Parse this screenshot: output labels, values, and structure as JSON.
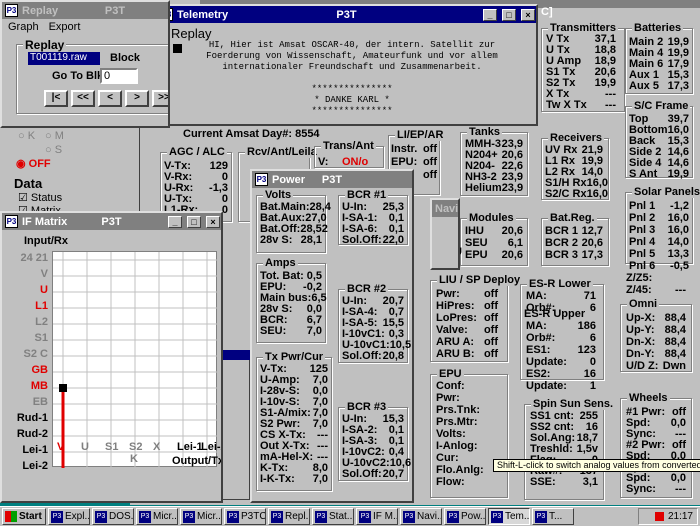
{
  "replay": {
    "title": "Replay",
    "menu": [
      "Graph",
      "Export"
    ],
    "group_label": "Replay",
    "file": "T001119.raw",
    "block_label": "Block",
    "block_value": "4",
    "goto_label": "Go To Blk:",
    "goto_value": "0",
    "nav_buttons": [
      "|<",
      "<<",
      "<",
      ">",
      ">>"
    ],
    "radio_k": "K",
    "radio_m": "M",
    "radio_s": "S",
    "radio_off": "OFF",
    "data_label": "Data",
    "chk_status": "Status",
    "chk_matrix": "Matrix"
  },
  "telemetry": {
    "title": "Telemetry",
    "center": "P3T",
    "heading": "Replay",
    "text": "HI, Hier ist Amsat OSCAR-40, der intern. Satellit zur Foerderung von Wissenschaft, Amateurfunk und vor allem internationaler Freundschaft und Zusammenarbeit.\n\n***************\n* DANKE KARL *\n***************"
  },
  "main_bg": {
    "current_label": "Current Amsat Day#:",
    "current_value": "8554",
    "agc_title": "AGC / ALC",
    "agc": [
      [
        "V-Tx:",
        "129"
      ],
      [
        "V-Rx:",
        "0"
      ],
      [
        "U-Rx:",
        "-1,3"
      ],
      [
        "U-Tx:",
        "0"
      ],
      [
        "L1-Rx:",
        "0"
      ]
    ],
    "rcv_title": "Rcv/Ant/Leila",
    "trans_title": "Trans/Ant",
    "trans_v": "V:",
    "trans_val": "ON/o",
    "liep_title": "LI/EP/AR",
    "liep": [
      [
        "Instr.",
        "off"
      ],
      [
        "EPU:",
        "off"
      ],
      [
        "In:",
        "off"
      ]
    ]
  },
  "right_panel": {
    "transmitters_title": "Transmitters",
    "transmitters": [
      [
        "V Tx",
        "37,1"
      ],
      [
        "U Tx",
        "18,8"
      ],
      [
        "U Amp",
        "18,9"
      ],
      [
        "S1 Tx",
        "20,6"
      ],
      [
        "S2 Tx",
        "19,9"
      ],
      [
        "X Tx",
        "---"
      ],
      [
        "Tw X Tx",
        "---"
      ]
    ],
    "batteries_title": "Batteries",
    "batteries": [
      [
        "Main 2",
        "19,9"
      ],
      [
        "Main 4",
        "19,9"
      ],
      [
        "Main 6",
        "17,9"
      ],
      [
        "Aux 1",
        "15,3"
      ],
      [
        "Aux 5",
        "17,3"
      ]
    ],
    "sc_title": "S/C Frame",
    "sc": [
      [
        "Top",
        "39,7"
      ],
      [
        "Bottom",
        "16,0"
      ],
      [
        "Back",
        "15,3"
      ],
      [
        "Side 2",
        "14,6"
      ],
      [
        "Side 4",
        "14,6"
      ],
      [
        "S Ant",
        "19,9"
      ]
    ],
    "tanks_title": "Tanks",
    "tanks": [
      [
        "MMH-3",
        "23,9"
      ],
      [
        "N204+",
        "20,6"
      ],
      [
        "N204-",
        "22,6"
      ],
      [
        "NH3-2",
        "23,9"
      ],
      [
        "Helium",
        "23,9"
      ]
    ],
    "receivers_title": "Receivers",
    "receivers": [
      [
        "UV Rx",
        "21,9"
      ],
      [
        "L1 Rx",
        "19,9"
      ],
      [
        "L2 Rx",
        "14,0"
      ],
      [
        "S1/H Rx",
        "16,0"
      ],
      [
        "S2/C Rx",
        "16,0"
      ]
    ],
    "solar_title": "Solar Panels",
    "solar": [
      [
        "Pnl 1",
        "-1,2"
      ],
      [
        "Pnl 2",
        "16,0"
      ],
      [
        "Pnl 3",
        "16,0"
      ],
      [
        "Pnl 4",
        "14,0"
      ],
      [
        "Pnl 5",
        "13,3"
      ],
      [
        "Pnl 6",
        "-0,5"
      ]
    ],
    "modules_title": "Modules",
    "modules": [
      [
        "IHU",
        "20,6"
      ],
      [
        "SEU",
        "6,1"
      ],
      [
        "EPU",
        "20,6"
      ]
    ],
    "batreg_title": "Bat.Reg.",
    "batreg": [
      [
        "BCR 1",
        "12,7"
      ],
      [
        "BCR 2",
        "20,6"
      ],
      [
        "BCR 3",
        "17,3"
      ]
    ],
    "z": [
      [
        "Z/Z5:",
        ""
      ],
      [
        "Z/45:",
        "---"
      ]
    ],
    "omni_title": "Omni",
    "omni": [
      [
        "Up-X:",
        "88,4"
      ],
      [
        "Up-Y:",
        "88,4"
      ],
      [
        "Dn-X:",
        "88,4"
      ],
      [
        "Dn-Y:",
        "88,4"
      ],
      [
        "U/D Z:",
        "Dwn"
      ]
    ],
    "wheels_title": "Wheels",
    "wheels": [
      [
        "#1 Pwr:",
        "off"
      ],
      [
        "Spd:",
        "0,0"
      ],
      [
        "Sync:",
        "---"
      ],
      [
        "#2 Pwr:",
        "off"
      ],
      [
        "Spd:",
        "0,0"
      ],
      [
        "Sync:",
        "---"
      ],
      [
        "Spd:",
        "0,0"
      ],
      [
        "Sync:",
        "---"
      ]
    ],
    "liu_title": "LIU / SP Deploy",
    "liu": [
      [
        "Pwr:",
        "off"
      ],
      [
        "HiPres:",
        "off"
      ],
      [
        "LoPres:",
        "off"
      ],
      [
        "Valve:",
        "off"
      ],
      [
        "ARU A:",
        "off"
      ],
      [
        "ARU B:",
        "off"
      ]
    ],
    "esr_lower": "ES-R Lower",
    "esr_lower_rows": [
      [
        "MA:",
        "71"
      ],
      [
        "Orb#:",
        "6"
      ]
    ],
    "esr_upper": "ES-R Upper",
    "esr_upper_rows": [
      [
        "MA:",
        "186"
      ],
      [
        "Orb#:",
        "6"
      ],
      [
        "ES1:",
        "123"
      ],
      [
        "Update:",
        "0"
      ],
      [
        "ES2:",
        "16"
      ],
      [
        "Update:",
        "1"
      ]
    ],
    "epu_title": "EPU",
    "epu": [
      [
        "Conf:",
        ""
      ],
      [
        "Pwr:",
        ""
      ],
      [
        "Prs.Tnk:",
        ""
      ],
      [
        "Prs.Mtr:",
        ""
      ],
      [
        "Volts:",
        ""
      ],
      [
        "I-Anlog:",
        ""
      ],
      [
        "Cur:",
        ""
      ],
      [
        "Flo.Anlg:",
        ""
      ],
      [
        "Flow:",
        ""
      ]
    ],
    "spin_title": "Spin Sun Sens.",
    "spin": [
      [
        "SS1 cnt:",
        "255"
      ],
      [
        "SS2 cnt:",
        "16"
      ],
      [
        "Sol.Ang:",
        "18,7"
      ],
      [
        "Treshld:",
        "1,5v"
      ],
      [
        "Flag:",
        "0"
      ],
      [
        "Raw#:",
        "137"
      ],
      [
        "SSE:",
        "3,1"
      ]
    ],
    "stat_prefix": "Stat",
    "mod_prefix": [
      "Mod",
      "Mag",
      "M-SU"
    ],
    "nav_prefix": "Navi",
    "c_prefix": "C]"
  },
  "power": {
    "title": "Power",
    "center": "P3T",
    "volts_title": "Volts",
    "volts": [
      [
        "Bat.Main:",
        "28,4"
      ],
      [
        "Bat.Aux:",
        "27,0"
      ],
      [
        "Bat.Off:",
        "28,52"
      ],
      [
        "28v S:",
        "28,1"
      ]
    ],
    "amps_title": "Amps",
    "amps": [
      [
        "Tot. Bat:",
        "0,5"
      ],
      [
        "EPU:",
        "-0,2"
      ],
      [
        "Main bus:",
        "6,5"
      ],
      [
        "28v S:",
        "0,0"
      ],
      [
        "BCR:",
        "6,7"
      ],
      [
        "SEU:",
        "7,0"
      ]
    ],
    "txpwr_title": "Tx Pwr/Cur",
    "txpwr": [
      [
        "V-Tx:",
        "125"
      ],
      [
        "U-Amp:",
        "7,0"
      ],
      [
        "I-28v-S:",
        "0,0"
      ],
      [
        "I-10v-S:",
        "7,0"
      ],
      [
        "S1-A/mix:",
        "7,0"
      ],
      [
        "S2 Pwr:",
        "7,0"
      ],
      [
        "CS X-Tx:",
        "---"
      ],
      [
        "Out X-Tx:",
        "---"
      ],
      [
        "mA-Hel-X:",
        "---"
      ],
      [
        "K-Tx:",
        "8,0"
      ],
      [
        "I-K-Tx:",
        "7,0"
      ]
    ],
    "bcr1_title": "BCR #1",
    "bcr1": [
      [
        "U-In:",
        "25,3"
      ],
      [
        "I-SA-1:",
        "0,1"
      ],
      [
        "I-SA-6:",
        "0,1"
      ],
      [
        "Sol.Off:",
        "22,0"
      ]
    ],
    "bcr2_title": "BCR #2",
    "bcr2": [
      [
        "U-In:",
        "20,7"
      ],
      [
        "I-SA-4:",
        "0,7"
      ],
      [
        "I-SA-5:",
        "15,5"
      ],
      [
        "I-10vC1:",
        "0,3"
      ],
      [
        "U-10vC1:",
        "10,5"
      ],
      [
        "Sol.Off:",
        "20,8"
      ]
    ],
    "bcr3_title": "BCR #3",
    "bcr3": [
      [
        "U-In:",
        "15,3"
      ],
      [
        "I-SA-2:",
        "0,1"
      ],
      [
        "I-SA-3:",
        "0,1"
      ],
      [
        "I-10vC2:",
        "0,4"
      ],
      [
        "U-10vC2:",
        "10,6"
      ],
      [
        "Sol.Off:",
        "20,7"
      ]
    ]
  },
  "ifmatrix": {
    "title": "IF Matrix",
    "center": "P3T",
    "corner": "Input/Rx",
    "rows": [
      {
        "label": "24 21",
        "color": "#808080"
      },
      {
        "label": "V",
        "color": "#808080"
      },
      {
        "label": "U",
        "color": "#e00000"
      },
      {
        "label": "L1",
        "color": "#e00000"
      },
      {
        "label": "L2",
        "color": "#808080"
      },
      {
        "label": "S1",
        "color": "#808080"
      },
      {
        "label": "S2 C",
        "color": "#808080"
      },
      {
        "label": "GB",
        "color": "#e00000"
      },
      {
        "label": "MB",
        "color": "#e00000"
      },
      {
        "label": "EB",
        "color": "#808080"
      },
      {
        "label": "Rud-1",
        "color": "#000000"
      },
      {
        "label": "Rud-2",
        "color": "#000000"
      },
      {
        "label": "Lei-1",
        "color": "#000000"
      },
      {
        "label": "Lei-2",
        "color": "#000000"
      }
    ],
    "cols": [
      {
        "label": "V",
        "color": "#e00000"
      },
      {
        "label": "U",
        "color": "#808080"
      },
      {
        "label": "S1",
        "color": "#808080"
      },
      {
        "label": "S2",
        "color": "#808080"
      },
      {
        "label": "X",
        "color": "#808080"
      },
      {
        "label": "Lei-1",
        "color": "#000000"
      },
      {
        "label": "Lei-2",
        "color": "#000000"
      }
    ],
    "sub_k": "K",
    "corner_bottom": "Output/Tx"
  },
  "tooltip": "Shift-L-click to switch analog values from converted to raw.",
  "taskbar": {
    "start": "Start",
    "items": [
      "Expl...",
      "DOS...",
      "Micr...",
      "Micr...",
      "P3TC",
      "Repl...",
      "Stat...",
      "IF M...",
      "Navi...",
      "Pow...",
      "Tem...",
      "T..."
    ],
    "clock": "21:17"
  }
}
